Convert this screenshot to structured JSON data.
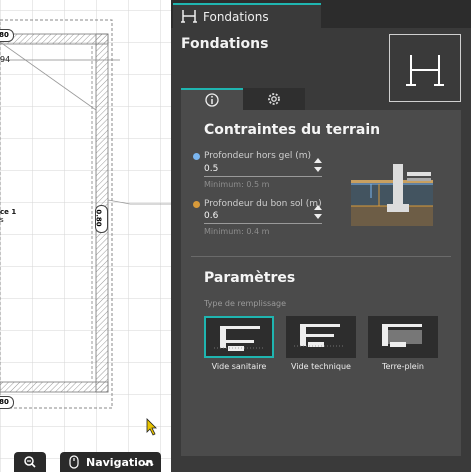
{
  "plan": {
    "dims": {
      "top": "80",
      "left_upper": "94",
      "vertical": "0.80",
      "bottom": "80"
    },
    "room": {
      "name": "ce 1",
      "sub": "s"
    }
  },
  "panel": {
    "tab": {
      "label": "Fondations",
      "icon": "foundation-icon"
    },
    "title": "Fondations",
    "inner_tabs": [
      {
        "icon": "info-icon"
      },
      {
        "icon": "gear-icon"
      }
    ],
    "terrain": {
      "heading": "Contraintes du terrain",
      "field1": {
        "label": "Profondeur hors gel (m)",
        "value": "0.5",
        "min": "Minimum: 0.5 m",
        "color": "#7bb6f0"
      },
      "field2": {
        "label": "Profondeur du bon sol (m)",
        "value": "0.6",
        "min": "Minimum: 0.4 m",
        "color": "#d89a3a"
      }
    },
    "params": {
      "heading": "Paramètres",
      "fill_label": "Type de remplissage",
      "options": [
        {
          "label": "Vide sanitaire",
          "selected": true
        },
        {
          "label": "Vide technique",
          "selected": false
        },
        {
          "label": "Terre-plein",
          "selected": false
        }
      ]
    }
  },
  "toolbar": {
    "navigation": "Navigation"
  },
  "colors": {
    "accent": "#1fb5b0",
    "panel_bg": "#3a3a3a",
    "card_bg": "#4b4b4b"
  }
}
